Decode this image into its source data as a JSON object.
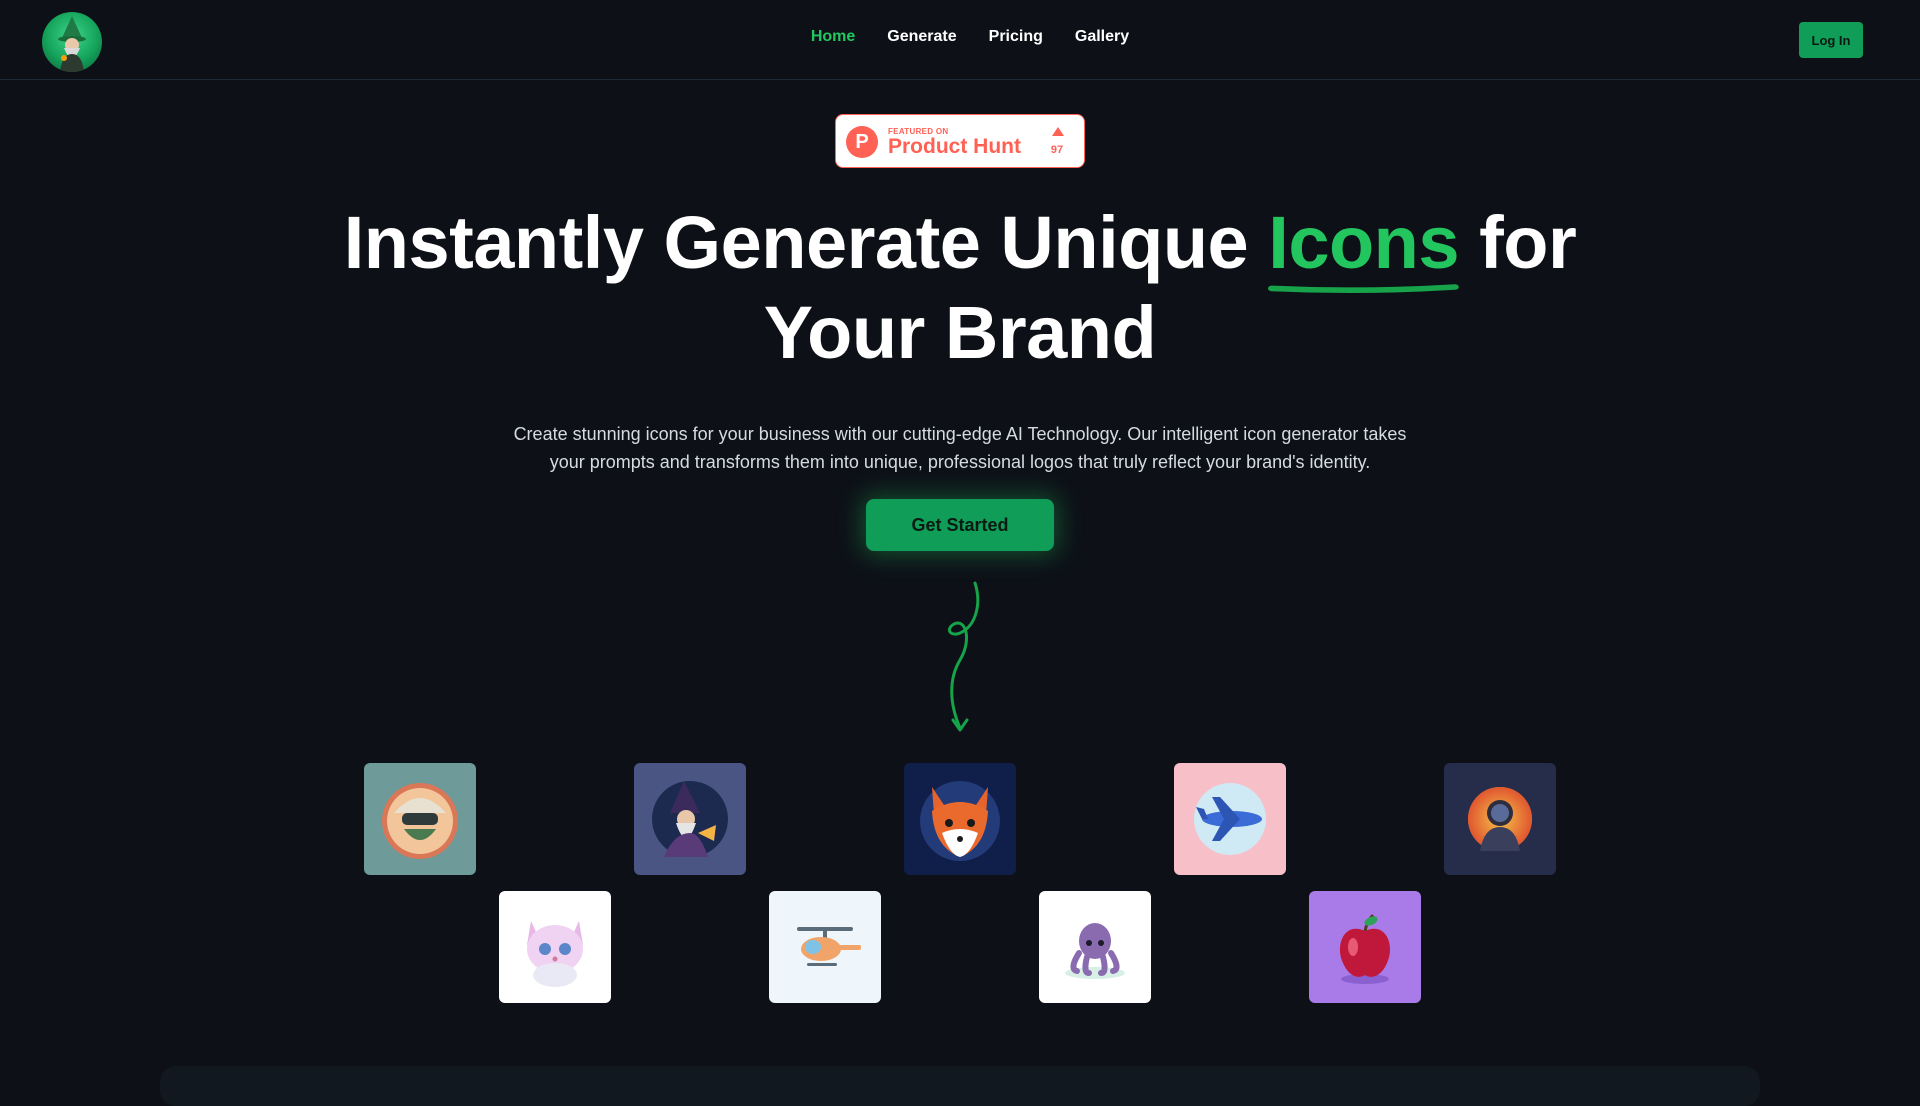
{
  "header": {
    "nav": [
      {
        "label": "Home",
        "active": true
      },
      {
        "label": "Generate",
        "active": false
      },
      {
        "label": "Pricing",
        "active": false
      },
      {
        "label": "Gallery",
        "active": false
      }
    ],
    "login_label": "Log In"
  },
  "product_hunt": {
    "featured_label": "FEATURED ON",
    "title": "Product Hunt",
    "upvotes": "97"
  },
  "hero": {
    "title_part1": "Instantly Generate Unique",
    "title_highlight": "Icons",
    "title_part2": "for",
    "title_line2": "Your Brand",
    "subtitle": "Create stunning icons for your business with our cutting-edge AI Technology. Our intelligent icon generator takes your prompts and transforms them into unique, professional logos that truly reflect your brand's identity.",
    "cta_label": "Get Started"
  },
  "gallery": {
    "icons": [
      "hardhat-worker-icon",
      "wizard-icon",
      "fox-icon",
      "airplane-icon",
      "astronaut-icon",
      "kitten-icon",
      "helicopter-icon",
      "octopus-icon",
      "apple-icon"
    ]
  },
  "colors": {
    "accent": "#22c55e",
    "button": "#0f9d58",
    "background": "#0d1117",
    "product_hunt": "#ff6154"
  }
}
